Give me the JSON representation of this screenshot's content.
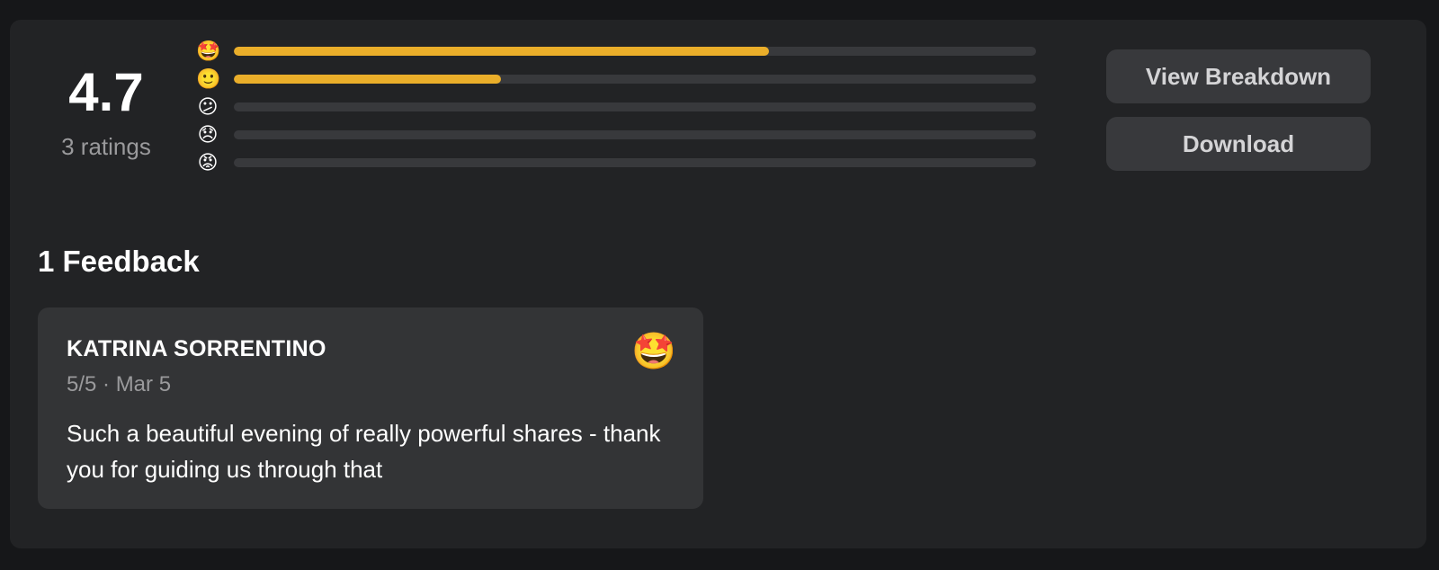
{
  "summary": {
    "average": "4.7",
    "count_label": "3 ratings"
  },
  "rating_bars": [
    {
      "icon": "star-struck-emoji-icon",
      "emoji": "🤩",
      "fill_fraction": 0.667
    },
    {
      "icon": "slightly-smiling-emoji-icon",
      "emoji": "🙂",
      "fill_fraction": 0.333
    },
    {
      "icon": "confused-emoji-icon",
      "emoji": "😕",
      "fill_fraction": 0
    },
    {
      "icon": "disappointed-emoji-icon",
      "emoji": "😞",
      "fill_fraction": 0
    },
    {
      "icon": "angry-emoji-icon",
      "emoji": "😡",
      "fill_fraction": 0
    }
  ],
  "actions": {
    "view_breakdown_label": "View Breakdown",
    "download_label": "Download"
  },
  "feedback": {
    "heading": "1 Feedback",
    "items": [
      {
        "name": "KATRINA SORRENTINO",
        "meta": "5/5 · Mar 5",
        "emoji": "🤩",
        "icon": "star-struck-emoji-icon",
        "text": "Such a beautiful evening of really powerful shares - thank you for guiding us through that"
      }
    ]
  },
  "colors": {
    "background": "#161719",
    "panel": "#222325",
    "card": "#333436",
    "bar_track": "#38393c",
    "bar_fill": "#eaae2a",
    "muted_text": "#9a9a9c"
  }
}
